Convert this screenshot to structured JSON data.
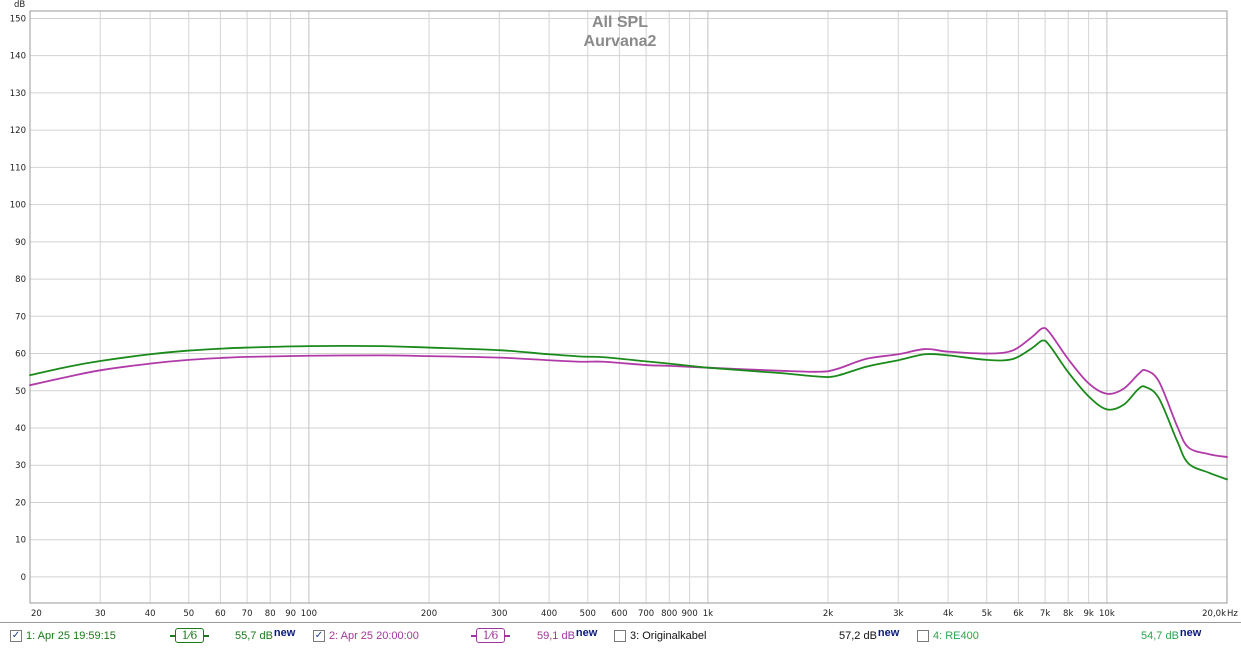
{
  "chart_data": {
    "type": "line",
    "title": "All SPL",
    "subtitle": "Aurvana2",
    "ylabel": "dB",
    "xlabel": "Hz",
    "xscale": "log",
    "xlim": [
      20,
      20000
    ],
    "ylim": [
      -7,
      152
    ],
    "grid": true,
    "y_ticks": [
      0,
      10,
      20,
      30,
      40,
      50,
      60,
      70,
      80,
      90,
      100,
      110,
      120,
      130,
      140,
      150
    ],
    "x_ticks": [
      {
        "value": 20,
        "label": "20"
      },
      {
        "value": 30,
        "label": "30"
      },
      {
        "value": 40,
        "label": "40"
      },
      {
        "value": 50,
        "label": "50"
      },
      {
        "value": 60,
        "label": "60"
      },
      {
        "value": 70,
        "label": "70"
      },
      {
        "value": 80,
        "label": "80"
      },
      {
        "value": 90,
        "label": "90"
      },
      {
        "value": 100,
        "label": "100"
      },
      {
        "value": 200,
        "label": "200"
      },
      {
        "value": 300,
        "label": "300"
      },
      {
        "value": 400,
        "label": "400"
      },
      {
        "value": 500,
        "label": "500"
      },
      {
        "value": 600,
        "label": "600"
      },
      {
        "value": 700,
        "label": "700"
      },
      {
        "value": 800,
        "label": "800"
      },
      {
        "value": 900,
        "label": "900"
      },
      {
        "value": 1000,
        "label": "1k"
      },
      {
        "value": 2000,
        "label": "2k"
      },
      {
        "value": 3000,
        "label": "3k"
      },
      {
        "value": 4000,
        "label": "4k"
      },
      {
        "value": 5000,
        "label": "5k"
      },
      {
        "value": 6000,
        "label": "6k"
      },
      {
        "value": 7000,
        "label": "7k"
      },
      {
        "value": 8000,
        "label": "8k"
      },
      {
        "value": 9000,
        "label": "9k"
      },
      {
        "value": 10000,
        "label": "10k"
      },
      {
        "value": 20000,
        "label": "20,0k"
      }
    ],
    "series": [
      {
        "name": "1: Apr 25 19:59:15",
        "color": "#1a8a1a",
        "x": [
          20,
          25,
          30,
          40,
          50,
          60,
          70,
          100,
          150,
          200,
          300,
          400,
          480,
          550,
          700,
          800,
          1000,
          1500,
          1900,
          2100,
          2500,
          3000,
          3500,
          4000,
          5000,
          5800,
          6500,
          6900,
          7200,
          8000,
          9000,
          10000,
          11000,
          12000,
          12500,
          13500,
          15000,
          16000,
          18000,
          20000
        ],
        "y": [
          54.2,
          56.5,
          58.0,
          59.8,
          60.8,
          61.3,
          61.6,
          62.0,
          62.0,
          61.6,
          60.9,
          59.8,
          59.2,
          59.0,
          57.9,
          57.3,
          56.2,
          54.8,
          53.8,
          54.0,
          56.5,
          58.2,
          59.8,
          59.5,
          58.3,
          58.5,
          61.5,
          63.5,
          62.0,
          55.0,
          48.5,
          45.0,
          46.2,
          50.5,
          51.0,
          48.0,
          36.5,
          30.5,
          28.0,
          26.2
        ]
      },
      {
        "name": "2: Apr 25 20:00:00",
        "color": "#b03aa8",
        "x": [
          20,
          25,
          30,
          40,
          50,
          60,
          70,
          100,
          150,
          200,
          300,
          400,
          480,
          550,
          700,
          800,
          1000,
          1500,
          1900,
          2100,
          2500,
          3000,
          3500,
          4000,
          5000,
          5800,
          6500,
          6900,
          7200,
          8000,
          9000,
          10000,
          11000,
          12000,
          12500,
          13500,
          15000,
          16000,
          18000,
          20000
        ],
        "y": [
          51.5,
          53.8,
          55.5,
          57.3,
          58.3,
          58.8,
          59.1,
          59.4,
          59.5,
          59.3,
          58.9,
          58.2,
          57.8,
          57.8,
          56.9,
          56.7,
          56.2,
          55.4,
          55.1,
          55.8,
          58.6,
          59.8,
          61.2,
          60.5,
          60.0,
          60.8,
          64.5,
          66.8,
          65.5,
          58.5,
          52.0,
          49.2,
          50.5,
          54.5,
          55.5,
          52.5,
          40.5,
          34.8,
          33.0,
          32.2
        ]
      }
    ]
  },
  "legend": {
    "items": [
      {
        "label": "1: Apr 25 19:59:15",
        "checked": true,
        "smoothing": "1⁄6",
        "level": "55,7 dB",
        "new": "new",
        "color": "#1a7a1a"
      },
      {
        "label": "2: Apr 25 20:00:00",
        "checked": true,
        "smoothing": "1⁄6",
        "level": "59,1 dB",
        "new": "new",
        "color": "#a0389a"
      },
      {
        "label": "3: Originalkabel",
        "checked": false,
        "level": "57,2 dB",
        "new": "new",
        "color": "#111111"
      },
      {
        "label": "4: RE400",
        "checked": false,
        "level": "54,7 dB",
        "new": "new",
        "color": "#2aa84a"
      }
    ]
  }
}
